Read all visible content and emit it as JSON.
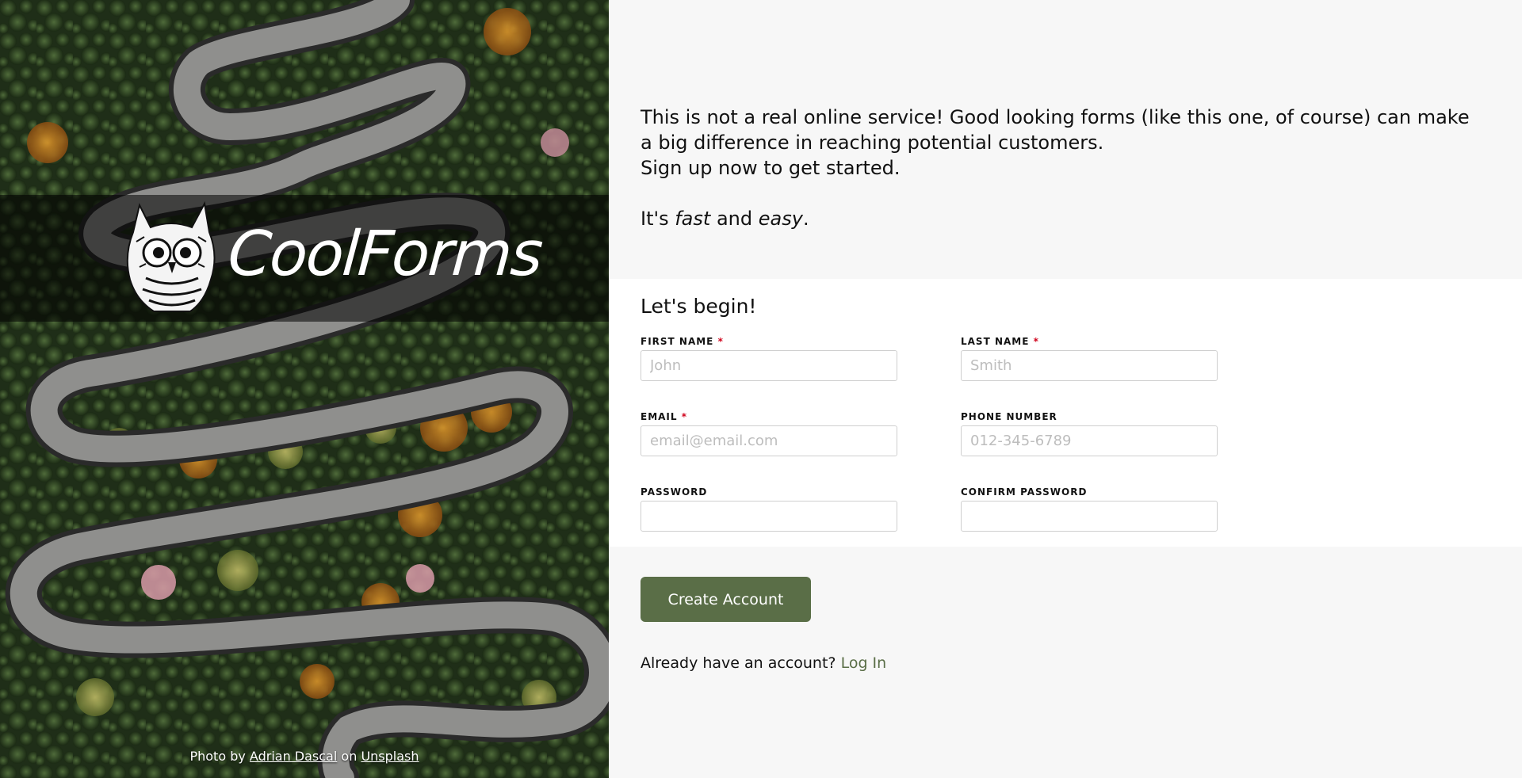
{
  "brand": {
    "name": "CoolForms",
    "logo_icon": "owl-icon"
  },
  "photo_credit": {
    "prefix": "Photo by",
    "author": "Adrian Dascal",
    "middle": "on",
    "source": "Unsplash"
  },
  "intro": {
    "line1": "This is not a real online service! Good looking forms (like this one, of course) can make a big difference in reaching potential customers.",
    "line2": "Sign up now to get started.",
    "tag_prefix": "It's",
    "tag_fast": "fast",
    "tag_and": "and",
    "tag_easy": "easy",
    "tag_suffix": "."
  },
  "form": {
    "title": "Let's begin!",
    "required_mark": "*",
    "first_name": {
      "label": "FIRST NAME",
      "placeholder": "John",
      "value": ""
    },
    "last_name": {
      "label": "LAST NAME",
      "placeholder": "Smith",
      "value": ""
    },
    "email": {
      "label": "EMAIL",
      "placeholder": "email@email.com",
      "value": ""
    },
    "phone": {
      "label": "PHONE NUMBER",
      "placeholder": "012-345-6789",
      "value": ""
    },
    "password": {
      "label": "PASSWORD",
      "placeholder": "",
      "value": ""
    },
    "confirm_password": {
      "label": "CONFIRM PASSWORD",
      "placeholder": "",
      "value": ""
    }
  },
  "actions": {
    "create_label": "Create Account",
    "login_prompt": "Already have an account?",
    "login_link": "Log In"
  },
  "colors": {
    "accent": "#5a6e47",
    "required": "#d0021b",
    "page_bg": "#f7f7f7",
    "card_bg": "#ffffff"
  }
}
